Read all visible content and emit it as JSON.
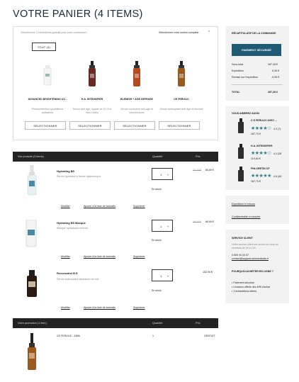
{
  "page": {
    "title": "VOTRE PANIER (4 ITEMS)"
  },
  "gifts": {
    "intro": "Sélectionnez 3 échantillons gratuits pour toute commande !",
    "discover": "Sélectionner votre routine complète",
    "sort_label": "TOUT (4)",
    "products": [
      {
        "name": "ADVANCED BRIGHTENING UV...",
        "desc": "Photoprotection quotidienne antitaches",
        "button": "SÉLECTIONNER"
      },
      {
        "name": "H.A. INTENSIFIER",
        "desc": "Sérum anti-âge, liquide de 30 % le tissu d'aléa",
        "button": "SÉLECTIONNER"
      },
      {
        "name": "BLEMISH + AGE DEFENSE",
        "desc": "Sérum correcteur anti-âge et imperfections",
        "button": "SÉLECTIONNER"
      },
      {
        "name": "CE FERULIC",
        "desc": "Sérum antioxydant anti-âge et fermeté",
        "button": "SÉLECTIONNER"
      }
    ]
  },
  "cart": {
    "header": {
      "products": "Vos produits (3 items)",
      "quantity": "Quantité",
      "price": "Prix"
    },
    "items": [
      {
        "name": "Hydrating B5",
        "desc": "Sérum hydratant à l'acide hyaluronique",
        "qty": "1",
        "old_price": "74,10 €",
        "price": "66,69 €",
        "stock": "En stock",
        "modify": "Modifier",
        "wishlist": "Ajouter à la liste de souhaits",
        "remove": "Supprimer"
      },
      {
        "name": "Hydrating B5 Masque",
        "desc": "Masque hydratation intense",
        "qty": "1",
        "old_price": "74,10 €",
        "price": "66,69 €",
        "stock": "En stock",
        "modify": "Modifier",
        "wishlist": "Ajouter à la liste de souhaits",
        "remove": "Supprimer"
      },
      {
        "name": "Resveratrol B E",
        "desc": "Sérum antioxydant réparateur de nuit",
        "qty": "1",
        "old_price": "",
        "price": "152,90 €",
        "stock": "En stock",
        "modify": "Modifier",
        "wishlist": "Ajouter à la liste de souhaits",
        "remove": "Supprimer"
      }
    ],
    "promo_header": {
      "label": "Votre promotion (1 item)",
      "quantity": "Quantité",
      "price": "Prix"
    },
    "promo_item": {
      "name": "CE FERULIC - 15ML",
      "qty": "1",
      "price": "GRATUIT"
    }
  },
  "summary": {
    "title": "RÉCAPITULATIF DE LA COMMANDE",
    "button": "PAIEMENT SÉCURISÉ",
    "lines": [
      {
        "label": "Sous-total",
        "value": "287,28 €"
      },
      {
        "label": "Expédition",
        "value": "5,95 €"
      },
      {
        "label": "Remise sur l'expédition",
        "value": "-5,95 €"
      }
    ],
    "total_label": "TOTAL",
    "total_value": "287,28 €"
  },
  "recommend": {
    "title": "VOUS AIMEREZ AUSSI",
    "items": [
      {
        "name": "C E FERULIC AVEC ...",
        "rating": "4.3 (7)",
        "price": "187,70 €"
      },
      {
        "name": "H.A. INTENSIFIER",
        "rating": "4.3 (28",
        "price": "119,80 €"
      },
      {
        "name": "PHLORETIN CF",
        "rating": "4.8 (46",
        "price": "187,70 €"
      }
    ]
  },
  "links": {
    "shipping": "Expédition et retours",
    "privacy": "Confidentialité et sécurité"
  },
  "service": {
    "title": "SERVICE CLIENT",
    "text": "Notre service client est ouvert du lundi au vendredi de 9h à 19h.",
    "phone": "0 800 94 00 57",
    "email": "contact@support-skinceuticals.fr",
    "why_title": "POURQUOI ACHETER EN LIGNE ?",
    "reasons": [
      "Paiement sécurisé",
      "Livraison offerte dès 49€ d'achat",
      "3 échantillons offerts"
    ]
  },
  "colors": {
    "accent": "#1f5a74",
    "dark_bar": "#232323",
    "star": "#2a7f8f"
  }
}
